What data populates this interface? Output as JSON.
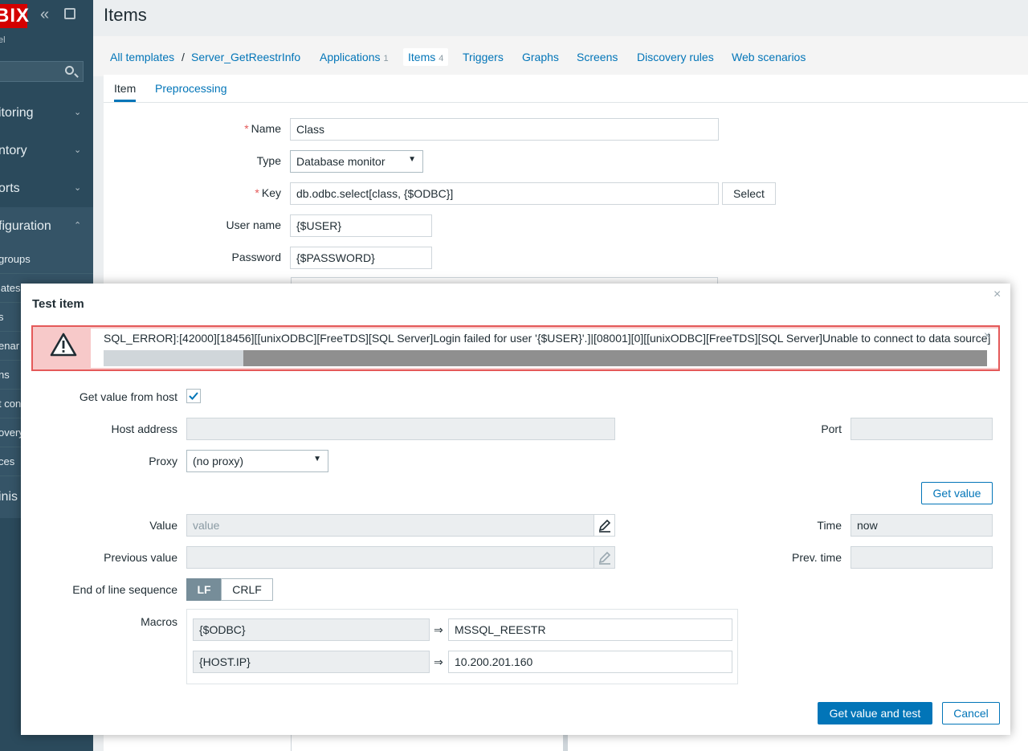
{
  "sidebar": {
    "logo": "BIX",
    "sub_label": "el",
    "menu": [
      {
        "label": "itoring",
        "chevron": "⌄"
      },
      {
        "label": "ntory",
        "chevron": "⌄"
      },
      {
        "label": "orts",
        "chevron": "⌄"
      },
      {
        "label": "figuration",
        "chevron": "⌃"
      }
    ],
    "subitems": [
      "groups",
      "lates",
      "s",
      "enar",
      "ns",
      "t con",
      "overy",
      "ces"
    ],
    "admin_label": "inis"
  },
  "page": {
    "title": "Items"
  },
  "breadcrumbs": {
    "all_templates": "All templates",
    "separator": "/",
    "template": "Server_GetReestrInfo",
    "applications": "Applications",
    "applications_count": "1",
    "items": "Items",
    "items_count": "4",
    "triggers": "Triggers",
    "graphs": "Graphs",
    "screens": "Screens",
    "discovery_rules": "Discovery rules",
    "web_scenarios": "Web scenarios"
  },
  "subtabs": {
    "item": "Item",
    "preprocessing": "Preprocessing"
  },
  "form": {
    "required_mark": "*",
    "name_label": "Name",
    "name_value": "Class",
    "type_label": "Type",
    "type_value": "Database monitor",
    "key_label": "Key",
    "key_value": "db.odbc.select[class, {$ODBC}]",
    "select_button": "Select",
    "username_label": "User name",
    "username_value": "{$USER}",
    "password_label": "Password",
    "password_value": "{$PASSWORD}"
  },
  "modal": {
    "title": "Test item",
    "close": "×",
    "error_text": "SQL_ERROR]:[42000][18456][[unixODBC][FreeTDS][SQL Server]Login failed for user '{$USER}'.]|[08001][0][[unixODBC][FreeTDS][SQL Server]Unable to connect to data source]",
    "error_close": "×",
    "get_value_from_host_label": "Get value from host",
    "get_value_from_host_checked": true,
    "host_address_label": "Host address",
    "host_address_value": "",
    "port_label": "Port",
    "port_value": "",
    "proxy_label": "Proxy",
    "proxy_value": "(no proxy)",
    "get_value_button": "Get value",
    "value_label": "Value",
    "value_placeholder": "value",
    "time_label": "Time",
    "time_value": "now",
    "previous_value_label": "Previous value",
    "prev_time_label": "Prev. time",
    "eol_label": "End of line sequence",
    "eol_lf": "LF",
    "eol_crlf": "CRLF",
    "macros_label": "Macros",
    "macros": [
      {
        "name": "{$ODBC}",
        "eq": "⇒",
        "value": "MSSQL_REESTR"
      },
      {
        "name": "{HOST.IP}",
        "eq": "⇒",
        "value": "10.200.201.160"
      }
    ],
    "get_value_and_test_button": "Get value and test",
    "cancel_button": "Cancel"
  },
  "colors": {
    "sidebar_bg": "#2b4a5c",
    "accent": "#0275b8",
    "error_bg": "#f7c9c9",
    "error_border": "#e45959",
    "logo_red": "#d40000"
  }
}
